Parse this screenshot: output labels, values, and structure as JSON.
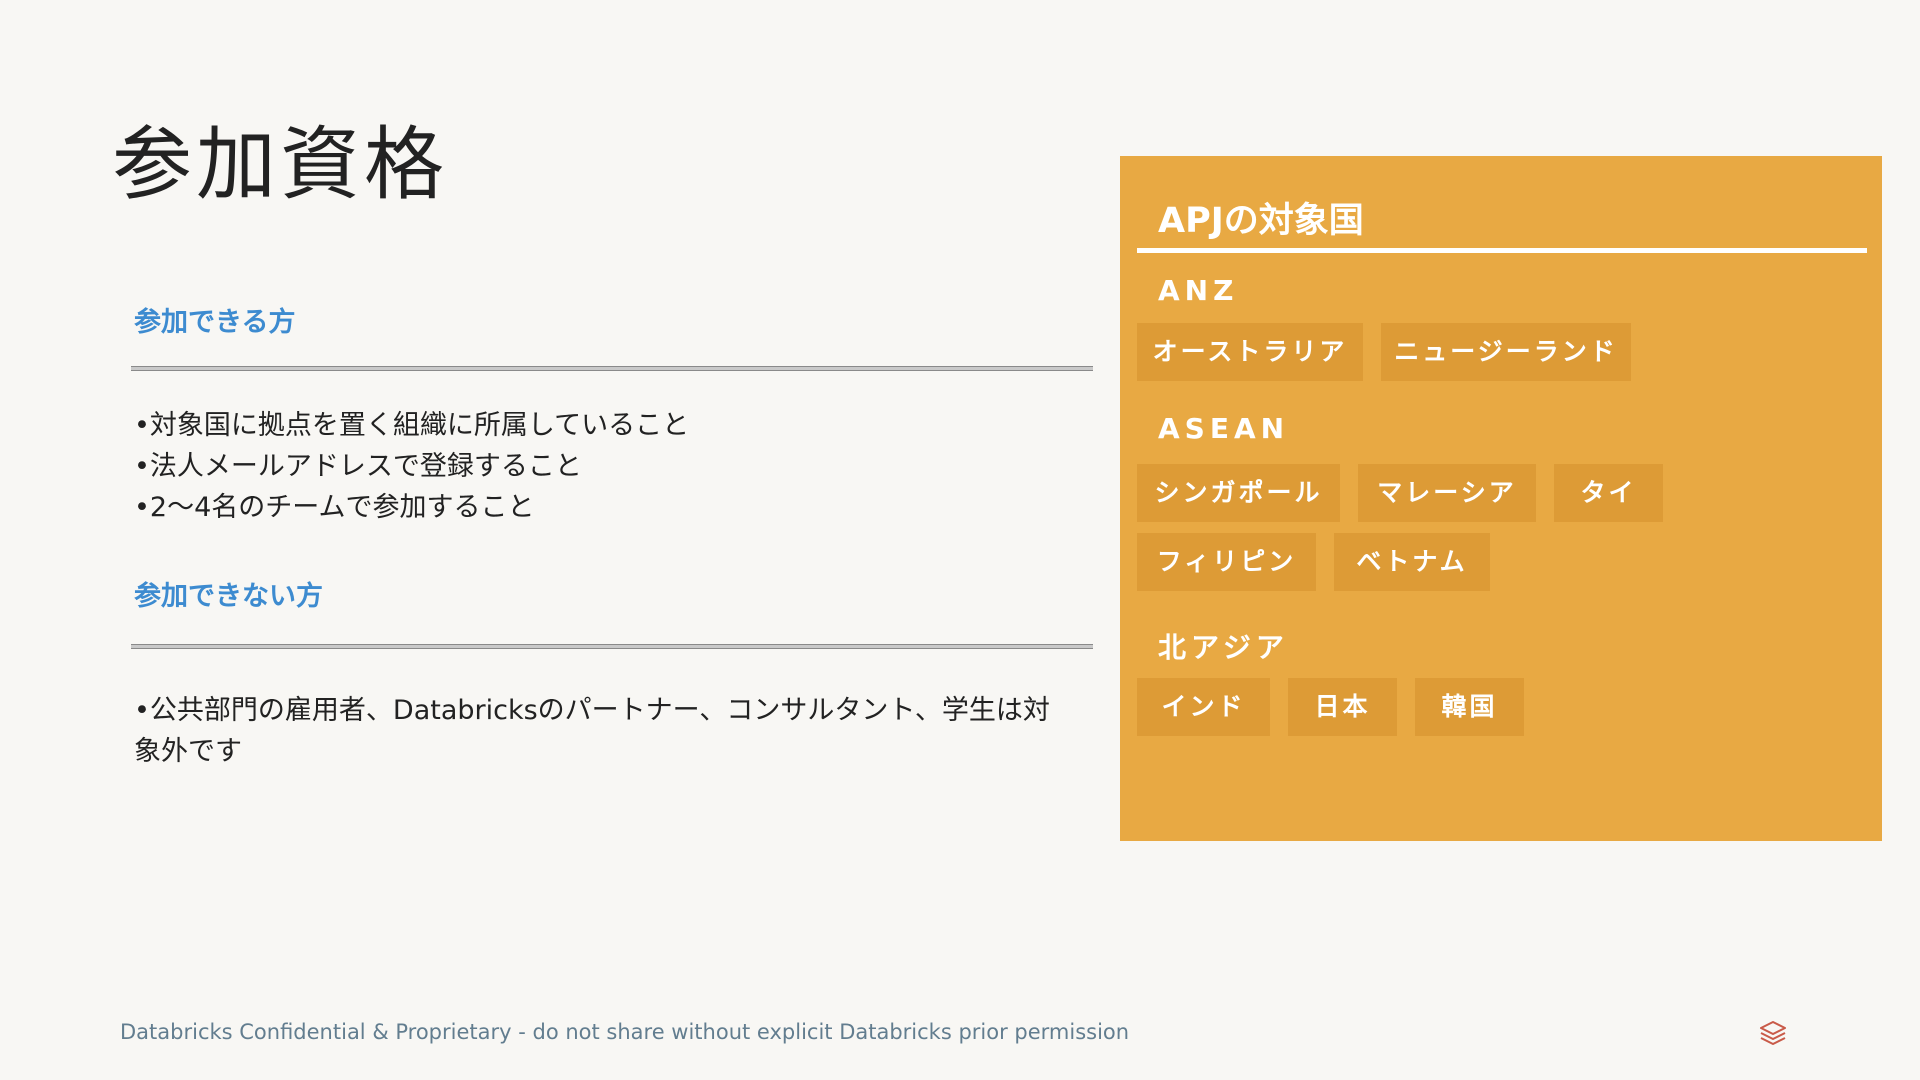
{
  "slide": {
    "title": "参加資格",
    "eligible": {
      "heading": "参加できる方",
      "bullets": [
        "•対象国に拠点を置く組織に所属していること",
        "•法人メールアドレスで登録すること",
        "•2〜4名のチームで参加すること"
      ]
    },
    "ineligible": {
      "heading": "参加できない方",
      "bullets": [
        "•公共部門の雇用者、Databricksのパートナー、コンサルタント、学生は対象外です"
      ]
    },
    "footer": "Databricks Confidential & Proprietary - do not share without explicit Databricks prior permission",
    "logo_icon": "databricks-stack-icon"
  },
  "panel": {
    "title": "APJの対象国",
    "regions": [
      {
        "name": "ANZ",
        "countries": [
          "オーストラリア",
          "ニュージーランド"
        ]
      },
      {
        "name": "ASEAN",
        "countries": [
          "シンガポール",
          "マレーシア",
          "タイ",
          "フィリピン",
          "ベトナム"
        ]
      },
      {
        "name": "北アジア",
        "countries": [
          "インド",
          "日本",
          "韓国"
        ]
      }
    ]
  },
  "colors": {
    "background": "#f8f7f4",
    "heading_blue": "#3d8bd0",
    "panel_orange": "#e8a943",
    "chip_orange": "#dd9b36",
    "logo_red": "#c95a48",
    "footer_text": "#627d8f"
  }
}
